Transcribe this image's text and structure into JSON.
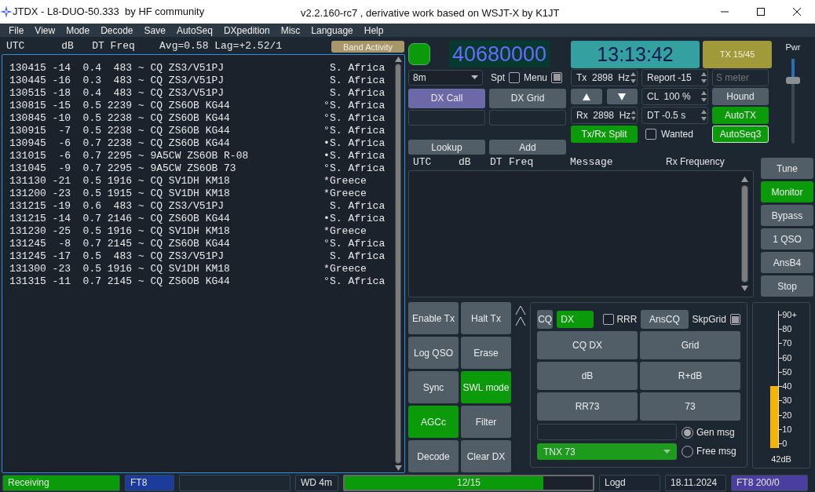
{
  "window": {
    "title": "JTDX - L8-DUO-50.333  by HF community",
    "subtitle": "v2.2.160-rc7 , derivative work based on WSJT-X by K1JT"
  },
  "menu": [
    "File",
    "View",
    "Mode",
    "Decode",
    "Save",
    "AutoSeq",
    "DXpedition",
    "Misc",
    "Language",
    "Help"
  ],
  "band_activity": {
    "header": "UTC      dB   DT Freq    Avg=0.58 Lag=+2.52/1",
    "button": "Band Activity",
    "rows": [
      {
        "line": "130415 -14  0.4  483 ~ CQ ZS3/V51PJ",
        "country": "S. Africa"
      },
      {
        "line": "130445 -16  0.3  483 ~ CQ ZS3/V51PJ",
        "country": "S. Africa"
      },
      {
        "line": "130515 -18  0.4  483 ~ CQ ZS3/V51PJ",
        "country": "S. Africa"
      },
      {
        "line": "130815 -15  0.5 2239 ~ CQ ZS6OB KG44",
        "marker": "°",
        "country": "S. Africa"
      },
      {
        "line": "130845 -10  0.5 2238 ~ CQ ZS6OB KG44",
        "marker": "°",
        "country": "S. Africa"
      },
      {
        "line": "130915  -7  0.5 2238 ~ CQ ZS6OB KG44",
        "marker": "°",
        "country": "S. Africa"
      },
      {
        "line": "130945  -6  0.7 2238 ~ CQ ZS6OB KG44",
        "marker": "•",
        "country": "S. Africa"
      },
      {
        "line": "131015  -6  0.7 2295 ~ 9A5CW ZS6OB R-08",
        "marker": "•",
        "country": "S. Africa"
      },
      {
        "line": "131045  -9  0.7 2295 ~ 9A5CW ZS6OB 73",
        "marker": "°",
        "country": "S. Africa"
      },
      {
        "line": "131130 -21  0.5 1916 ~ CQ SV1DH KM18",
        "marker": "*",
        "country": "Greece"
      },
      {
        "line": "131200 -23  0.5 1915 ~ CQ SV1DH KM18",
        "marker": "*",
        "country": "Greece"
      },
      {
        "line": "131215 -19  0.6  483 ~ CQ ZS3/V51PJ",
        "country": "S. Africa"
      },
      {
        "line": "131215 -14  0.7 2146 ~ CQ ZS6OB KG44",
        "marker": "•",
        "country": "S. Africa"
      },
      {
        "line": "131230 -25  0.5 1916 ~ CQ SV1DH KM18",
        "marker": "*",
        "country": "Greece"
      },
      {
        "line": "131245  -8  0.7 2145 ~ CQ ZS6OB KG44",
        "marker": "°",
        "country": "S. Africa"
      },
      {
        "line": "131245 -17  0.5  483 ~ CQ ZS3/V51PJ",
        "country": "S. Africa"
      },
      {
        "line": "131300 -23  0.5 1916 ~ CQ SV1DH KM18",
        "marker": "*",
        "country": "Greece"
      },
      {
        "line": "131315 -11  0.7 2145 ~ CQ ZS6OB KG44",
        "marker": "°",
        "country": "S. Africa"
      }
    ]
  },
  "frequency": "40680000",
  "band": "8m",
  "spt": {
    "label": "Spt",
    "checked": false
  },
  "menu_toggle": {
    "label": "Menu",
    "checked": true
  },
  "dx_call": "DX Call",
  "dx_grid": "DX Grid",
  "lookup": "Lookup",
  "add": "Add",
  "clock": "13:13:42",
  "tx_period": "TX 15/45",
  "spinners": [
    {
      "text": "Tx  2898  Hz"
    },
    {
      "text": "Report -15"
    },
    {
      "text": "CL  100 %"
    },
    {
      "text": "Rx  2898  Hz"
    },
    {
      "text": "DT -0.5 s"
    }
  ],
  "s_meter": {
    "placeholder": "S meter"
  },
  "hound": {
    "label": "Hound",
    "on": false
  },
  "autotx": {
    "label": "AutoTX",
    "on": true
  },
  "autoseq": {
    "label": "AutoSeq3",
    "on": true
  },
  "split": {
    "label": "Tx/Rx Split",
    "on": true
  },
  "wanted": {
    "label": "Wanted",
    "checked": false
  },
  "pwr": {
    "label": "Pwr",
    "level": 0.75
  },
  "rx_columns": [
    "UTC",
    "dB",
    "DT",
    "Freq",
    "Message",
    "Rx Frequency"
  ],
  "side_buttons": [
    {
      "label": "Tune",
      "on": false
    },
    {
      "label": "Monitor",
      "on": true
    },
    {
      "label": "Bypass",
      "on": false
    },
    {
      "label": "1 QSO",
      "on": false
    },
    {
      "label": "AnsB4",
      "on": false
    },
    {
      "label": "Stop",
      "on": false
    }
  ],
  "controls": [
    {
      "label": "Enable Tx",
      "on": false
    },
    {
      "label": "Halt Tx",
      "on": false
    },
    {
      "label": "Log QSO",
      "on": false
    },
    {
      "label": "Erase",
      "on": false
    },
    {
      "label": "Sync",
      "on": false
    },
    {
      "label": "SWL mode",
      "on": true
    },
    {
      "label": "AGCc",
      "on": true
    },
    {
      "label": "Filter",
      "on": false
    },
    {
      "label": "Decode",
      "on": false
    },
    {
      "label": "Clear DX",
      "on": false
    }
  ],
  "messages": {
    "cq": "CQ",
    "dx": {
      "label": "DX",
      "on": true
    },
    "rrr": {
      "label": "RRR",
      "checked": false
    },
    "anscq": "AnsCQ",
    "skpgrid": {
      "label": "SkpGrid",
      "checked": true
    },
    "buttons": [
      "CQ DX",
      "Grid",
      "dB",
      "R+dB",
      "RR73",
      "73"
    ],
    "free_text": "TNX 73",
    "modes": [
      {
        "label": "Gen msg",
        "selected": true
      },
      {
        "label": "Free msg",
        "selected": false
      }
    ]
  },
  "meter": {
    "ticks": [
      "90+",
      "80",
      "70",
      "60",
      "50",
      "40",
      "30",
      "20",
      "10",
      "0"
    ],
    "level": 0.467,
    "reading": "42dB"
  },
  "status_bar": [
    {
      "kind": "text",
      "text": "Receiving",
      "color": "#0a9a0a"
    },
    {
      "kind": "text",
      "text": "FT8",
      "color": "#1c3c9c"
    },
    {
      "kind": "blank"
    },
    {
      "kind": "text",
      "text": "WD 4m",
      "color": "#1b2430"
    },
    {
      "kind": "progress",
      "text": "12/15",
      "level": 0.8
    },
    {
      "kind": "text",
      "text": "Logd",
      "color": "#1b2430"
    },
    {
      "kind": "text",
      "text": "18.11.2024",
      "color": "#1b2430"
    },
    {
      "kind": "text",
      "text": "FT8  200/0",
      "color": "#4a3fa0"
    }
  ]
}
